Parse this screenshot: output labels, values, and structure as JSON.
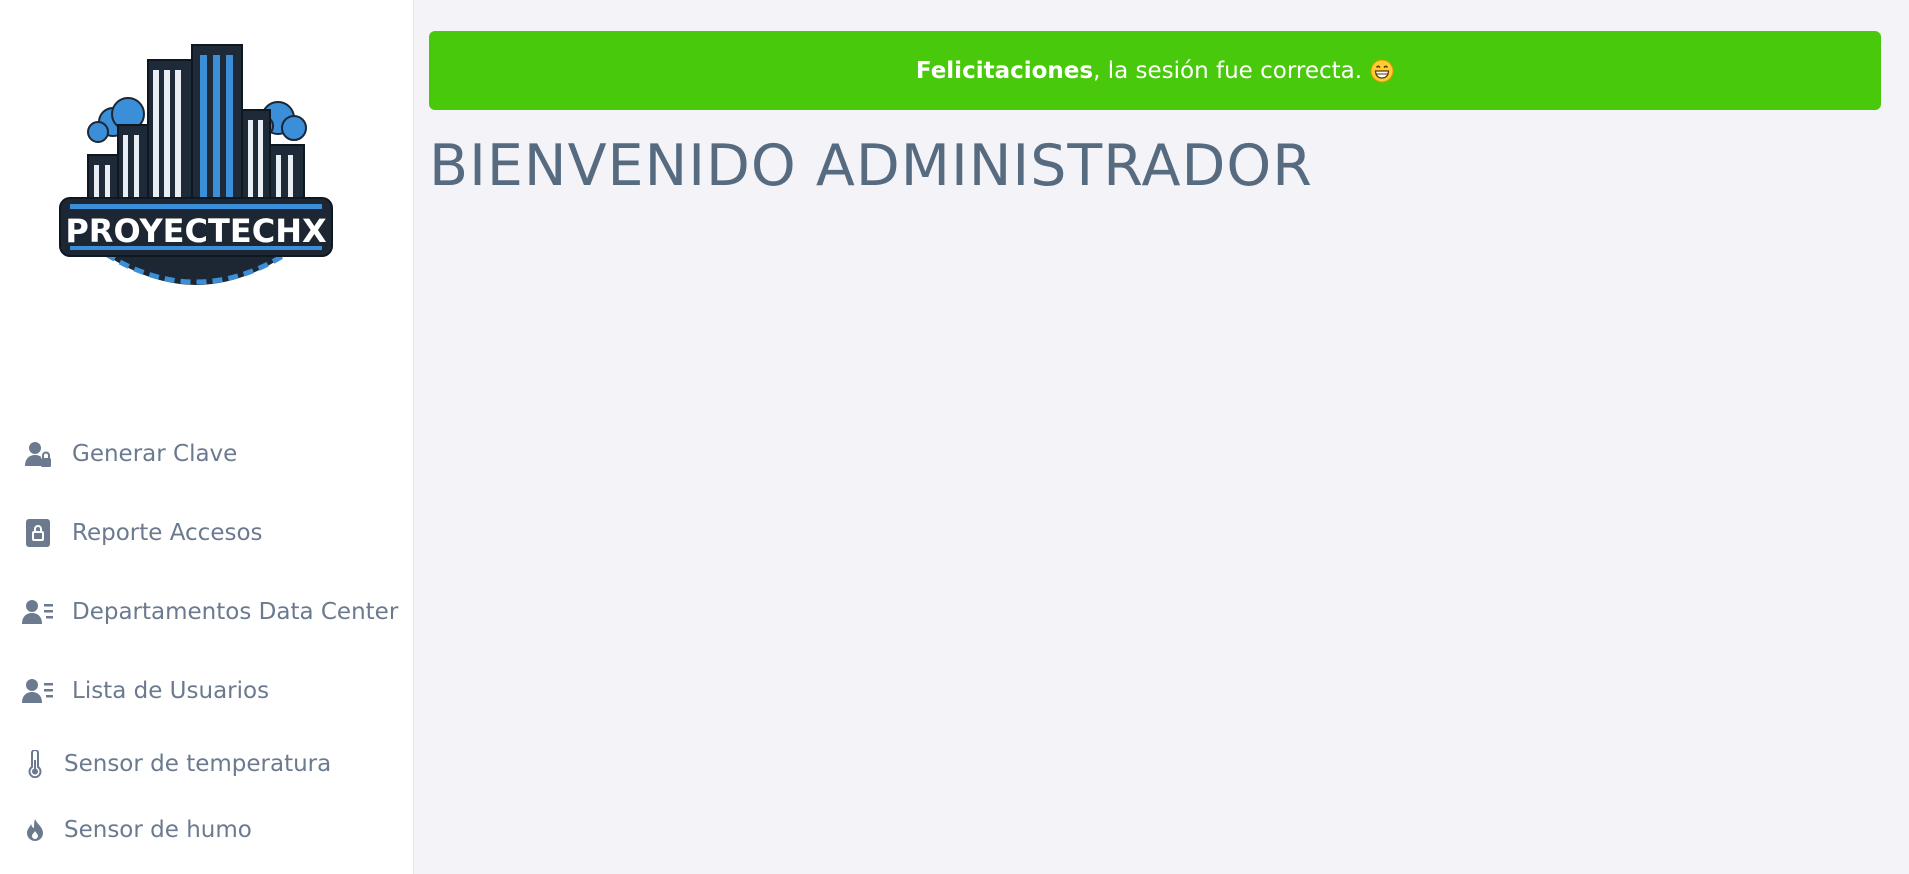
{
  "brand": {
    "logo_text": "PROYECTECHX"
  },
  "sidebar": {
    "items": [
      {
        "label": "Generar Clave",
        "icon": "user-lock-icon"
      },
      {
        "label": "Reporte Accesos",
        "icon": "lock-square-icon"
      },
      {
        "label": "Departamentos Data Center",
        "icon": "user-list-icon"
      },
      {
        "label": "Lista de Usuarios",
        "icon": "user-list-icon"
      },
      {
        "label": "Sensor de temperatura",
        "icon": "thermometer-icon"
      },
      {
        "label": "Sensor de humo",
        "icon": "fire-icon"
      }
    ]
  },
  "alert": {
    "strong": "Felicitaciones",
    "message": ", la sesión fue correcta.",
    "emoji": "grinning-face-icon",
    "color": "#49c90b"
  },
  "main": {
    "title": "BIENVENIDO ADMINISTRADOR"
  },
  "colors": {
    "sidebar_text": "#6b7a8f",
    "title": "#566a80",
    "background": "#f3f3f8"
  }
}
